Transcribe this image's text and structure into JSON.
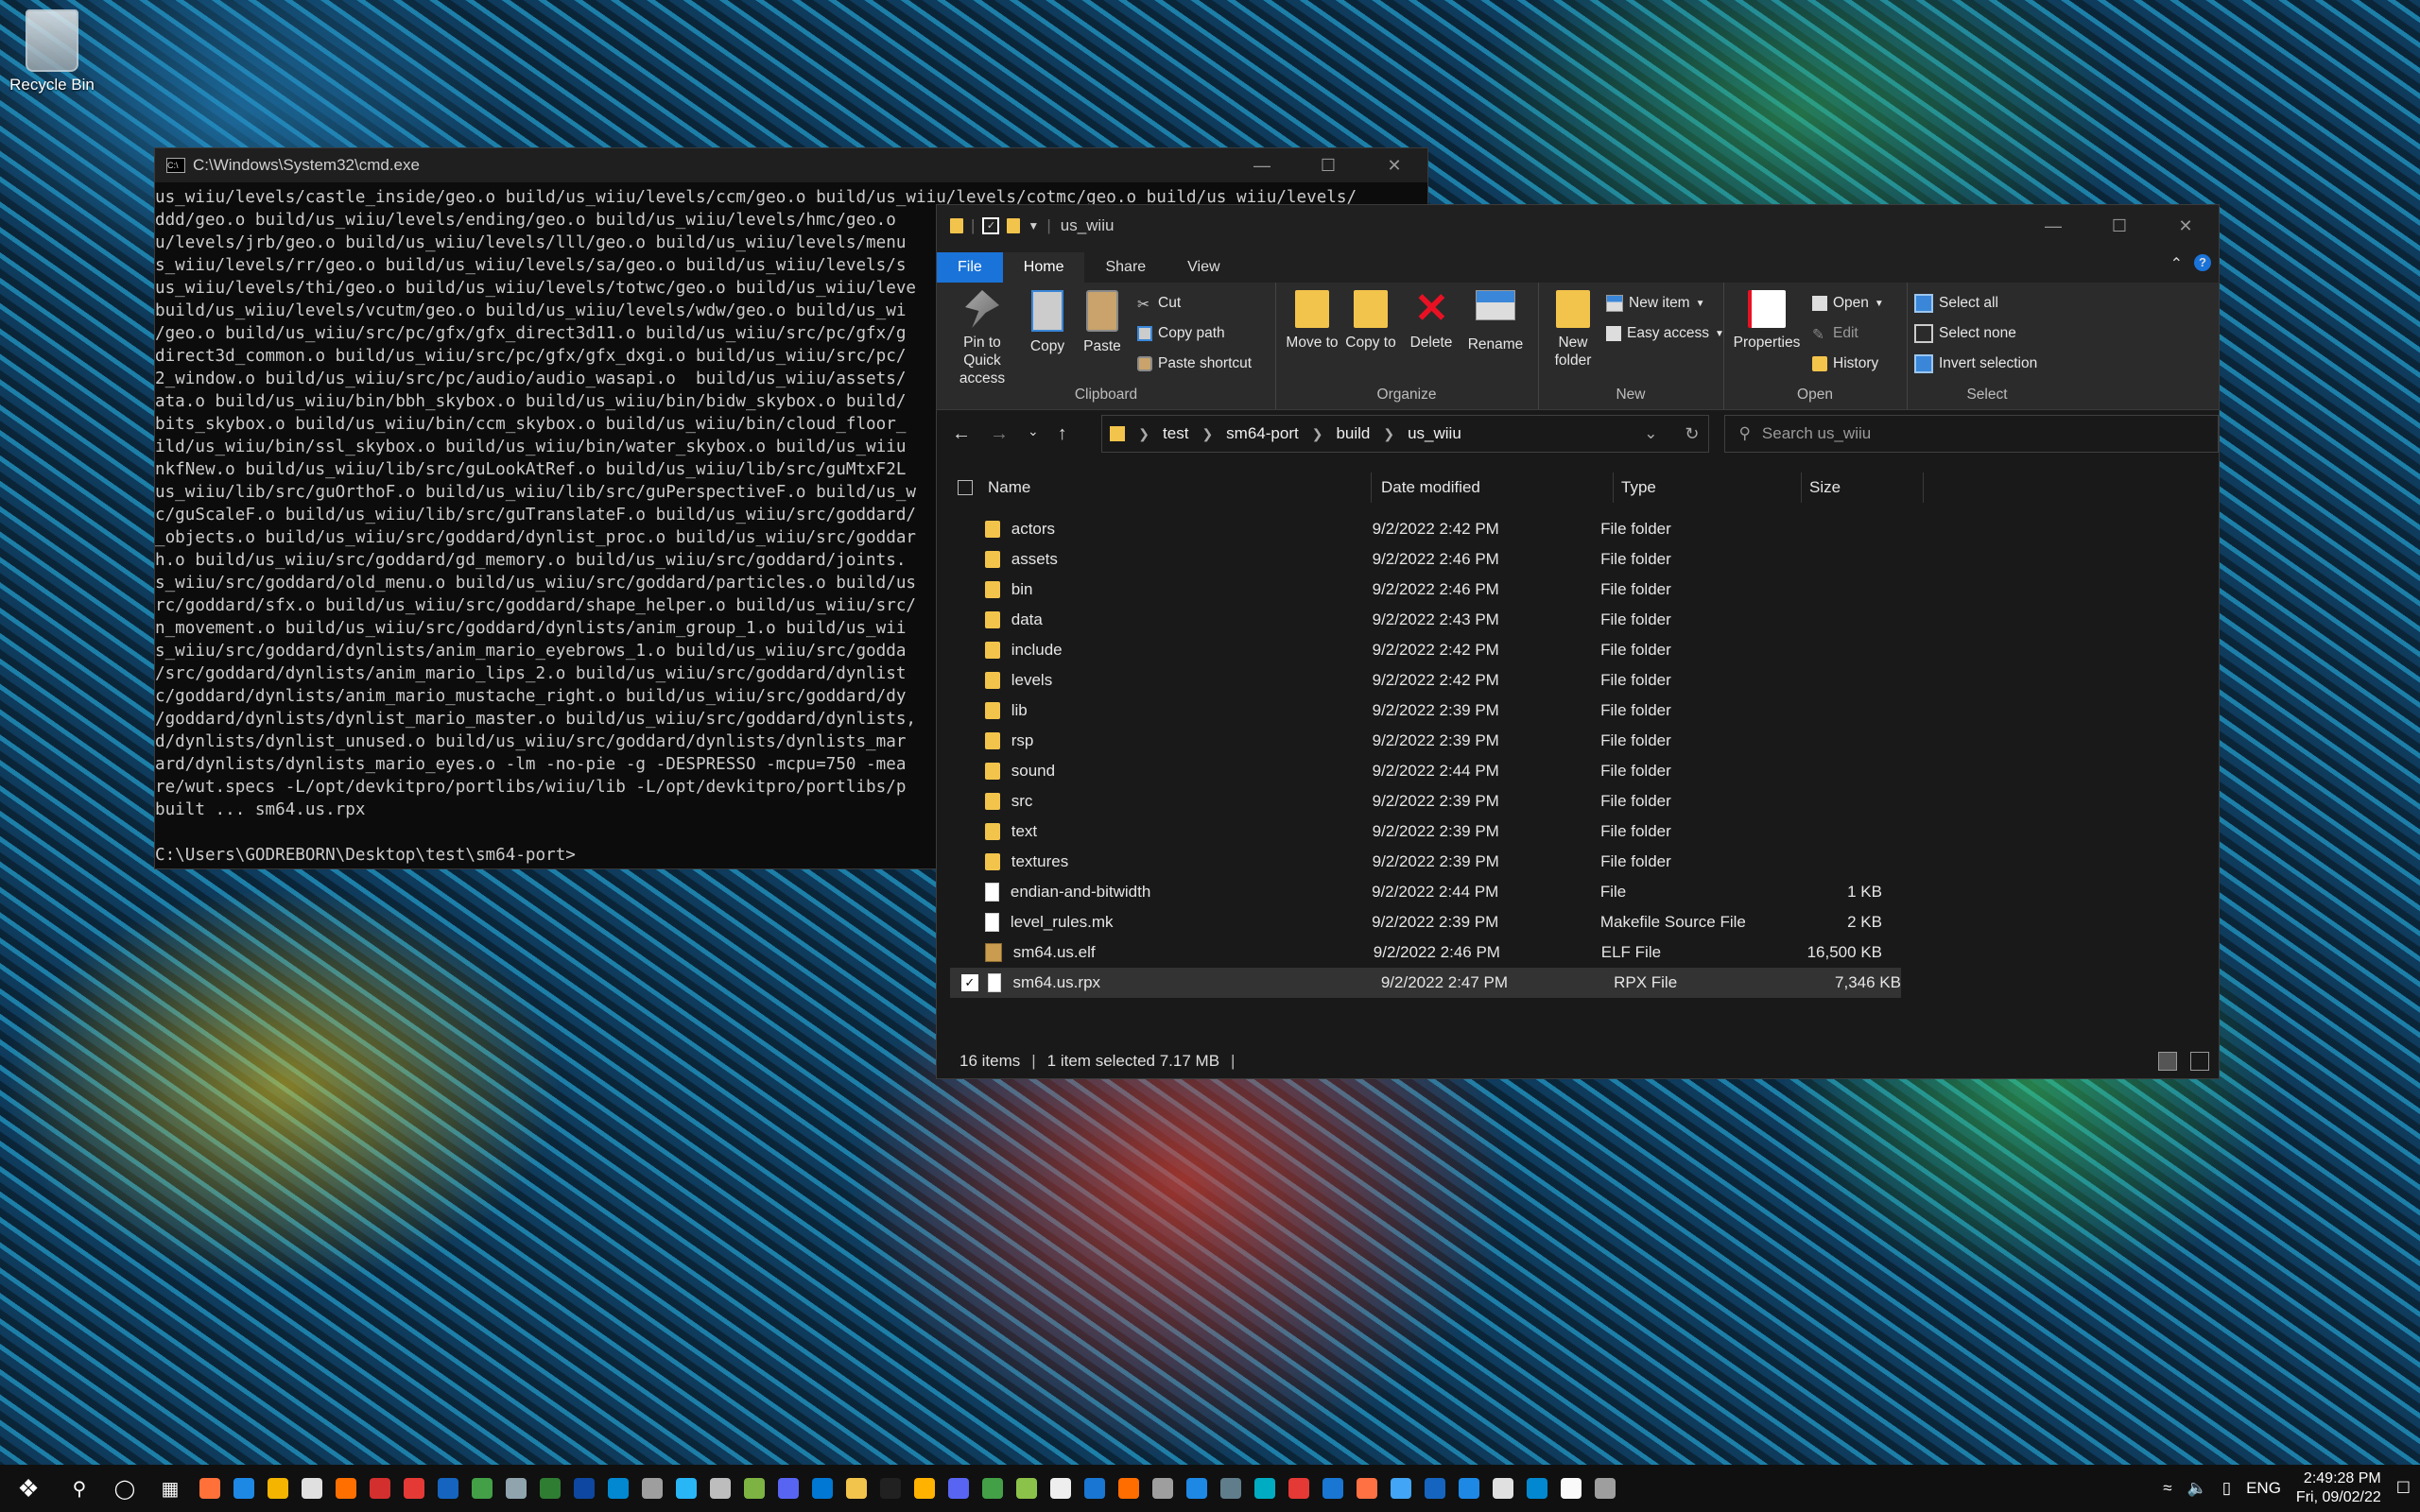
{
  "desktop": {
    "recycle_bin_label": "Recycle Bin"
  },
  "cmd": {
    "title": "C:\\Windows\\System32\\cmd.exe",
    "lines": [
      "us_wiiu/levels/castle_inside/geo.o build/us_wiiu/levels/ccm/geo.o build/us_wiiu/levels/cotmc/geo.o build/us_wiiu/levels/",
      "ddd/geo.o build/us_wiiu/levels/ending/geo.o build/us_wiiu/levels/hmc/geo.o",
      "u/levels/jrb/geo.o build/us_wiiu/levels/lll/geo.o build/us_wiiu/levels/menu",
      "s_wiiu/levels/rr/geo.o build/us_wiiu/levels/sa/geo.o build/us_wiiu/levels/s",
      "us_wiiu/levels/thi/geo.o build/us_wiiu/levels/totwc/geo.o build/us_wiiu/leve",
      "build/us_wiiu/levels/vcutm/geo.o build/us_wiiu/levels/wdw/geo.o build/us_wi",
      "/geo.o build/us_wiiu/src/pc/gfx/gfx_direct3d11.o build/us_wiiu/src/pc/gfx/g",
      "direct3d_common.o build/us_wiiu/src/pc/gfx/gfx_dxgi.o build/us_wiiu/src/pc/",
      "2_window.o build/us_wiiu/src/pc/audio/audio_wasapi.o  build/us_wiiu/assets/",
      "ata.o build/us_wiiu/bin/bbh_skybox.o build/us_wiiu/bin/bidw_skybox.o build/",
      "bits_skybox.o build/us_wiiu/bin/ccm_skybox.o build/us_wiiu/bin/cloud_floor_",
      "ild/us_wiiu/bin/ssl_skybox.o build/us_wiiu/bin/water_skybox.o build/us_wiiu",
      "nkfNew.o build/us_wiiu/lib/src/guLookAtRef.o build/us_wiiu/lib/src/guMtxF2L",
      "us_wiiu/lib/src/guOrthoF.o build/us_wiiu/lib/src/guPerspectiveF.o build/us_w",
      "c/guScaleF.o build/us_wiiu/lib/src/guTranslateF.o build/us_wiiu/src/goddard/",
      "_objects.o build/us_wiiu/src/goddard/dynlist_proc.o build/us_wiiu/src/goddar",
      "h.o build/us_wiiu/src/goddard/gd_memory.o build/us_wiiu/src/goddard/joints.",
      "s_wiiu/src/goddard/old_menu.o build/us_wiiu/src/goddard/particles.o build/us",
      "rc/goddard/sfx.o build/us_wiiu/src/goddard/shape_helper.o build/us_wiiu/src/",
      "n_movement.o build/us_wiiu/src/goddard/dynlists/anim_group_1.o build/us_wii",
      "s_wiiu/src/goddard/dynlists/anim_mario_eyebrows_1.o build/us_wiiu/src/godda",
      "/src/goddard/dynlists/anim_mario_lips_2.o build/us_wiiu/src/goddard/dynlist",
      "c/goddard/dynlists/anim_mario_mustache_right.o build/us_wiiu/src/goddard/dy",
      "/goddard/dynlists/dynlist_mario_master.o build/us_wiiu/src/goddard/dynlists,",
      "d/dynlists/dynlist_unused.o build/us_wiiu/src/goddard/dynlists/dynlists_mar",
      "ard/dynlists/dynlists_mario_eyes.o -lm -no-pie -g -DESPRESSO -mcpu=750 -mea",
      "re/wut.specs -L/opt/devkitpro/portlibs/wiiu/lib -L/opt/devkitpro/portlibs/p",
      "built ... sm64.us.rpx",
      "",
      "C:\\Users\\GODREBORN\\Desktop\\test\\sm64-port>"
    ]
  },
  "explorer": {
    "title": "us_wiiu",
    "tabs": [
      "File",
      "Home",
      "Share",
      "View"
    ],
    "ribbon": {
      "clipboard": {
        "label": "Clipboard",
        "pin": "Pin to Quick access",
        "copy": "Copy",
        "paste": "Paste",
        "cut": "Cut",
        "copy_path": "Copy path",
        "paste_shortcut": "Paste shortcut"
      },
      "organize": {
        "label": "Organize",
        "move_to": "Move to",
        "copy_to": "Copy to",
        "delete": "Delete",
        "rename": "Rename"
      },
      "new": {
        "label": "New",
        "new_folder": "New folder",
        "new_item": "New item",
        "easy_access": "Easy access"
      },
      "open": {
        "label": "Open",
        "properties": "Properties",
        "open": "Open",
        "edit": "Edit",
        "history": "History"
      },
      "select": {
        "label": "Select",
        "select_all": "Select all",
        "select_none": "Select none",
        "invert_selection": "Invert selection"
      }
    },
    "path": [
      "test",
      "sm64-port",
      "build",
      "us_wiiu"
    ],
    "search_placeholder": "Search us_wiiu",
    "columns": {
      "name": "Name",
      "date": "Date modified",
      "type": "Type",
      "size": "Size"
    },
    "files": [
      {
        "name": "actors",
        "date": "9/2/2022 2:42 PM",
        "type": "File folder",
        "size": "",
        "icon": "folder-icon"
      },
      {
        "name": "assets",
        "date": "9/2/2022 2:46 PM",
        "type": "File folder",
        "size": "",
        "icon": "folder-icon"
      },
      {
        "name": "bin",
        "date": "9/2/2022 2:46 PM",
        "type": "File folder",
        "size": "",
        "icon": "folder-icon"
      },
      {
        "name": "data",
        "date": "9/2/2022 2:43 PM",
        "type": "File folder",
        "size": "",
        "icon": "folder-icon"
      },
      {
        "name": "include",
        "date": "9/2/2022 2:42 PM",
        "type": "File folder",
        "size": "",
        "icon": "folder-icon"
      },
      {
        "name": "levels",
        "date": "9/2/2022 2:42 PM",
        "type": "File folder",
        "size": "",
        "icon": "folder-icon"
      },
      {
        "name": "lib",
        "date": "9/2/2022 2:39 PM",
        "type": "File folder",
        "size": "",
        "icon": "folder-icon"
      },
      {
        "name": "rsp",
        "date": "9/2/2022 2:39 PM",
        "type": "File folder",
        "size": "",
        "icon": "folder-icon"
      },
      {
        "name": "sound",
        "date": "9/2/2022 2:44 PM",
        "type": "File folder",
        "size": "",
        "icon": "folder-icon"
      },
      {
        "name": "src",
        "date": "9/2/2022 2:39 PM",
        "type": "File folder",
        "size": "",
        "icon": "folder-icon"
      },
      {
        "name": "text",
        "date": "9/2/2022 2:39 PM",
        "type": "File folder",
        "size": "",
        "icon": "folder-icon"
      },
      {
        "name": "textures",
        "date": "9/2/2022 2:39 PM",
        "type": "File folder",
        "size": "",
        "icon": "folder-icon"
      },
      {
        "name": "endian-and-bitwidth",
        "date": "9/2/2022 2:44 PM",
        "type": "File",
        "size": "1 KB",
        "icon": "file-icon"
      },
      {
        "name": "level_rules.mk",
        "date": "9/2/2022 2:39 PM",
        "type": "Makefile Source File",
        "size": "2 KB",
        "icon": "file-icon"
      },
      {
        "name": "sm64.us.elf",
        "date": "9/2/2022 2:46 PM",
        "type": "ELF File",
        "size": "16,500 KB",
        "icon": "elf-file-icon"
      },
      {
        "name": "sm64.us.rpx",
        "date": "9/2/2022 2:47 PM",
        "type": "RPX File",
        "size": "7,346 KB",
        "icon": "file-icon",
        "selected": true
      }
    ],
    "status": {
      "count": "16 items",
      "selected": "1 item selected  7.17 MB"
    }
  },
  "taskbar": {
    "language": "ENG",
    "time": "2:49:28 PM",
    "date": "Fri, 09/02/22"
  }
}
